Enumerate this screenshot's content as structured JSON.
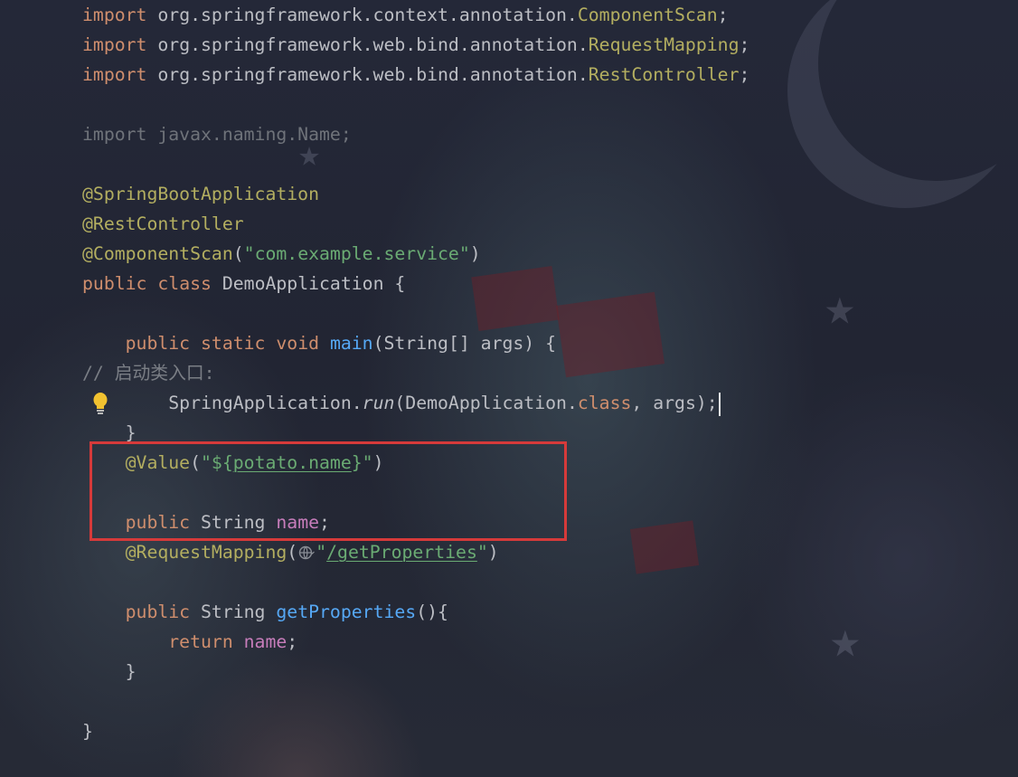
{
  "editor": {
    "lines": [
      {
        "id": "l1",
        "segments": [
          [
            "import ",
            "kw"
          ],
          [
            "org.springframework.context.annotation.",
            ""
          ],
          [
            "ComponentScan",
            "ann"
          ],
          [
            ";",
            ""
          ]
        ]
      },
      {
        "id": "l2",
        "segments": [
          [
            "import ",
            "kw"
          ],
          [
            "org.springframework.web.bind.annotation.",
            ""
          ],
          [
            "RequestMapping",
            "ann"
          ],
          [
            ";",
            ""
          ]
        ]
      },
      {
        "id": "l3",
        "segments": [
          [
            "import ",
            "kw"
          ],
          [
            "org.springframework.web.bind.annotation.",
            ""
          ],
          [
            "RestController",
            "ann"
          ],
          [
            ";",
            ""
          ]
        ]
      },
      {
        "id": "l4",
        "segments": []
      },
      {
        "id": "l5",
        "segments": [
          [
            "import javax.naming.Name;",
            "dim"
          ]
        ]
      },
      {
        "id": "l6",
        "segments": []
      },
      {
        "id": "l7",
        "segments": [
          [
            "@SpringBootApplication",
            "ann"
          ]
        ]
      },
      {
        "id": "l8",
        "segments": [
          [
            "@RestController",
            "ann"
          ]
        ]
      },
      {
        "id": "l9",
        "segments": [
          [
            "@ComponentScan",
            "ann"
          ],
          [
            "(",
            ""
          ],
          [
            "\"com.example.service\"",
            "str"
          ],
          [
            ")",
            ""
          ]
        ]
      },
      {
        "id": "l10",
        "segments": [
          [
            "public ",
            "kw"
          ],
          [
            "class ",
            "kw"
          ],
          [
            "DemoApplication {",
            ""
          ]
        ]
      },
      {
        "id": "l11",
        "segments": []
      },
      {
        "id": "l12",
        "segments": [
          [
            "    public ",
            "kw"
          ],
          [
            "static ",
            "kw"
          ],
          [
            "void ",
            "kw"
          ],
          [
            "main",
            "fn"
          ],
          [
            "(String[] args) {",
            ""
          ]
        ]
      },
      {
        "id": "l13",
        "segments": [
          [
            "// 启动类入口:",
            "cmt"
          ]
        ]
      },
      {
        "id": "l14",
        "segments": [
          [
            "        SpringApplication.",
            ""
          ],
          [
            "run",
            "italic"
          ],
          [
            "(DemoApplication.",
            ""
          ],
          [
            "class",
            "kw"
          ],
          [
            ", args);",
            ""
          ]
        ],
        "caret": true
      },
      {
        "id": "l15",
        "segments": [
          [
            "    }",
            ""
          ]
        ]
      },
      {
        "id": "l16",
        "segments": [
          [
            "    @Value",
            "ann"
          ],
          [
            "(",
            ""
          ],
          [
            "\"${",
            "str"
          ],
          [
            "potato.name",
            "str link"
          ],
          [
            "}\"",
            "str"
          ],
          [
            ")",
            ""
          ]
        ]
      },
      {
        "id": "l17",
        "segments": []
      },
      {
        "id": "l18",
        "segments": [
          [
            "    public ",
            "kw"
          ],
          [
            "String ",
            ""
          ],
          [
            "name",
            "fld"
          ],
          [
            ";",
            ""
          ]
        ]
      },
      {
        "id": "l19",
        "segments": [
          [
            "    @RequestMapping",
            "ann"
          ],
          [
            "(",
            ""
          ],
          [
            "GLOBE",
            "globe"
          ],
          [
            "\"",
            "str"
          ],
          [
            "/getProperties",
            "str link"
          ],
          [
            "\"",
            "str"
          ],
          [
            ")",
            ""
          ]
        ]
      },
      {
        "id": "l20",
        "segments": []
      },
      {
        "id": "l21",
        "segments": [
          [
            "    public ",
            "kw"
          ],
          [
            "String ",
            ""
          ],
          [
            "getProperties",
            "fn"
          ],
          [
            "(){",
            ""
          ]
        ]
      },
      {
        "id": "l22",
        "segments": [
          [
            "        return ",
            "kw"
          ],
          [
            "name",
            "fld"
          ],
          [
            ";",
            ""
          ]
        ]
      },
      {
        "id": "l23",
        "segments": [
          [
            "    }",
            ""
          ]
        ]
      },
      {
        "id": "l24",
        "segments": []
      },
      {
        "id": "l25",
        "segments": [
          [
            "}",
            ""
          ]
        ]
      }
    ]
  },
  "icons": {
    "bulb": "lightbulb-icon",
    "globe": "globe-icon"
  },
  "colors": {
    "keyword": "#cf8e6d",
    "annotation": "#b3ae60",
    "string": "#6aab73",
    "function": "#56a8f5",
    "field": "#c77dbb",
    "highlight_border": "#d63a3a"
  }
}
